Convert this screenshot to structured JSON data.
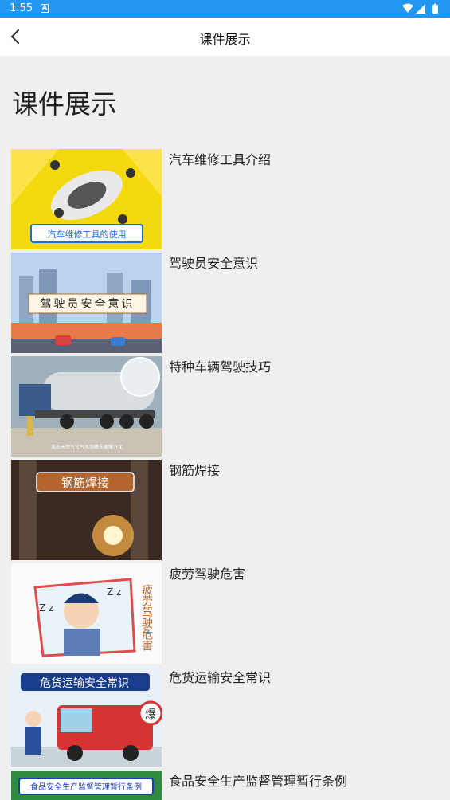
{
  "status": {
    "time": "1:55",
    "sim_badge": "A"
  },
  "appbar": {
    "title": "课件展示"
  },
  "page": {
    "heading": "课件展示"
  },
  "courses": [
    {
      "title": "汽车维修工具介绍",
      "thumb_caption": "汽车维修工具的使用"
    },
    {
      "title": "驾驶员安全意识",
      "thumb_caption": "驾驶员安全意识"
    },
    {
      "title": "特种车辆驾驶技巧",
      "thumb_caption": "液态天然气化气水泡罐车易爆汽化"
    },
    {
      "title": "钢筋焊接",
      "thumb_caption": "钢筋焊接"
    },
    {
      "title": "疲劳驾驶危害",
      "thumb_caption": "疲劳驾驶危害"
    },
    {
      "title": "危货运输安全常识",
      "thumb_caption": "危货运输安全常识",
      "thumb_badge": "爆"
    },
    {
      "title": "食品安全生产监督管理暂行条例",
      "thumb_caption": "食品安全生产监督管理暂行条例"
    }
  ],
  "colors": {
    "statusbar": "#2196f3",
    "appbar": "#ffffff",
    "background": "#efefef"
  }
}
